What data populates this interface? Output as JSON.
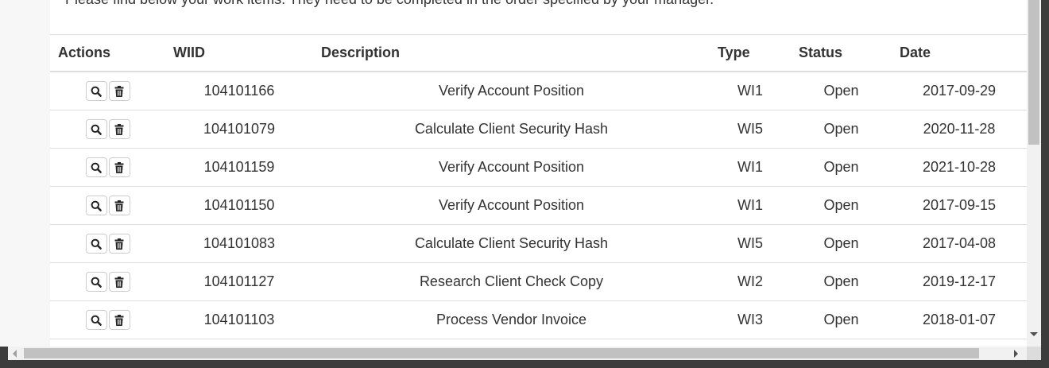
{
  "intro_text": "Please find below your work items. They need to be completed in the order specified by your manager.",
  "table": {
    "headers": {
      "actions": "Actions",
      "wiid": "WIID",
      "description": "Description",
      "type": "Type",
      "status": "Status",
      "date": "Date"
    },
    "rows": [
      {
        "wiid": "104101166",
        "description": "Verify Account Position",
        "type": "WI1",
        "status": "Open",
        "date": "2017-09-29"
      },
      {
        "wiid": "104101079",
        "description": "Calculate Client Security Hash",
        "type": "WI5",
        "status": "Open",
        "date": "2020-11-28"
      },
      {
        "wiid": "104101159",
        "description": "Verify Account Position",
        "type": "WI1",
        "status": "Open",
        "date": "2021-10-28"
      },
      {
        "wiid": "104101150",
        "description": "Verify Account Position",
        "type": "WI1",
        "status": "Open",
        "date": "2017-09-15"
      },
      {
        "wiid": "104101083",
        "description": "Calculate Client Security Hash",
        "type": "WI5",
        "status": "Open",
        "date": "2017-04-08"
      },
      {
        "wiid": "104101127",
        "description": "Research Client Check Copy",
        "type": "WI2",
        "status": "Open",
        "date": "2019-12-17"
      },
      {
        "wiid": "104101103",
        "description": "Process Vendor Invoice",
        "type": "WI3",
        "status": "Open",
        "date": "2018-01-07"
      }
    ]
  },
  "icons": {
    "view": "search-icon",
    "delete": "trash-icon"
  },
  "colors": {
    "border": "#dddddd",
    "text": "#333333",
    "button_border": "#cccccc",
    "scrollbar_thumb": "#c1c1c1"
  }
}
